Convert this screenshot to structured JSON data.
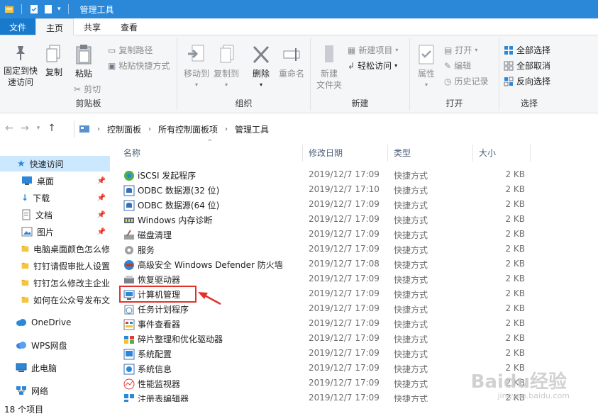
{
  "window": {
    "title": "管理工具"
  },
  "tabs": [
    {
      "label": "文件"
    },
    {
      "label": "主页"
    },
    {
      "label": "共享"
    },
    {
      "label": "查看"
    }
  ],
  "ribbon": {
    "clipboard": {
      "label": "剪贴板",
      "pin_quick": "固定到快速访问",
      "copy": "复制",
      "paste": "粘贴",
      "copy_path": "复制路径",
      "paste_shortcut": "粘贴快捷方式",
      "cut": "剪切"
    },
    "organize": {
      "label": "组织",
      "move_to": "移动到",
      "copy_to": "复制到",
      "delete": "删除",
      "rename": "重命名"
    },
    "new": {
      "label": "新建",
      "new_folder": "新建\n文件夹",
      "new_item": "新建项目",
      "easy_access": "轻松访问"
    },
    "open": {
      "label": "打开",
      "properties": "属性",
      "open": "打开",
      "edit": "编辑",
      "history": "历史记录"
    },
    "select": {
      "label": "选择",
      "select_all": "全部选择",
      "select_none": "全部取消",
      "invert": "反向选择"
    }
  },
  "address": {
    "crumbs": [
      "控制面板",
      "所有控制面板项",
      "管理工具"
    ]
  },
  "sidebar": {
    "items": [
      {
        "label": "快速访问",
        "icon": "star-icon"
      },
      {
        "label": "桌面",
        "icon": "desktop-icon"
      },
      {
        "label": "下载",
        "icon": "download-icon"
      },
      {
        "label": "文档",
        "icon": "document-icon"
      },
      {
        "label": "图片",
        "icon": "pictures-icon"
      },
      {
        "label": "电脑桌面颜色怎么修",
        "icon": "folder-icon"
      },
      {
        "label": "钉钉请假审批人设置",
        "icon": "folder-icon"
      },
      {
        "label": "钉钉怎么修改主企业",
        "icon": "folder-icon"
      },
      {
        "label": "如何在公众号发布文",
        "icon": "folder-icon"
      },
      {
        "label": "OneDrive",
        "icon": "cloud-icon"
      },
      {
        "label": "WPS网盘",
        "icon": "wps-cloud-icon"
      },
      {
        "label": "此电脑",
        "icon": "computer-icon"
      },
      {
        "label": "网络",
        "icon": "network-icon"
      }
    ]
  },
  "columns": {
    "name": "名称",
    "date": "修改日期",
    "type": "类型",
    "size": "大小"
  },
  "files": [
    {
      "name": "iSCSI 发起程序",
      "date": "2019/12/7 17:09",
      "type": "快捷方式",
      "size": "2 KB"
    },
    {
      "name": "ODBC 数据源(32 位)",
      "date": "2019/12/7 17:10",
      "type": "快捷方式",
      "size": "2 KB"
    },
    {
      "name": "ODBC 数据源(64 位)",
      "date": "2019/12/7 17:09",
      "type": "快捷方式",
      "size": "2 KB"
    },
    {
      "name": "Windows 内存诊断",
      "date": "2019/12/7 17:09",
      "type": "快捷方式",
      "size": "2 KB"
    },
    {
      "name": "磁盘清理",
      "date": "2019/12/7 17:09",
      "type": "快捷方式",
      "size": "2 KB"
    },
    {
      "name": "服务",
      "date": "2019/12/7 17:09",
      "type": "快捷方式",
      "size": "2 KB"
    },
    {
      "name": "高级安全 Windows Defender 防火墙",
      "date": "2019/12/7 17:08",
      "type": "快捷方式",
      "size": "2 KB"
    },
    {
      "name": "恢复驱动器",
      "date": "2019/12/7 17:09",
      "type": "快捷方式",
      "size": "2 KB"
    },
    {
      "name": "计算机管理",
      "date": "2019/12/7 17:09",
      "type": "快捷方式",
      "size": "2 KB"
    },
    {
      "name": "任务计划程序",
      "date": "2019/12/7 17:09",
      "type": "快捷方式",
      "size": "2 KB"
    },
    {
      "name": "事件查看器",
      "date": "2019/12/7 17:09",
      "type": "快捷方式",
      "size": "2 KB"
    },
    {
      "name": "碎片整理和优化驱动器",
      "date": "2019/12/7 17:09",
      "type": "快捷方式",
      "size": "2 KB"
    },
    {
      "name": "系统配置",
      "date": "2019/12/7 17:09",
      "type": "快捷方式",
      "size": "2 KB"
    },
    {
      "name": "系统信息",
      "date": "2019/12/7 17:09",
      "type": "快捷方式",
      "size": "2 KB"
    },
    {
      "name": "性能监视器",
      "date": "2019/12/7 17:09",
      "type": "快捷方式",
      "size": "2 KB"
    },
    {
      "name": "注册表编辑器",
      "date": "2019/12/7 17:09",
      "type": "快捷方式",
      "size": "2 KB"
    }
  ],
  "status": {
    "count": "18 个项目"
  },
  "watermark": {
    "brand": "Baidu经验",
    "url": "jingyan.baidu.com"
  }
}
